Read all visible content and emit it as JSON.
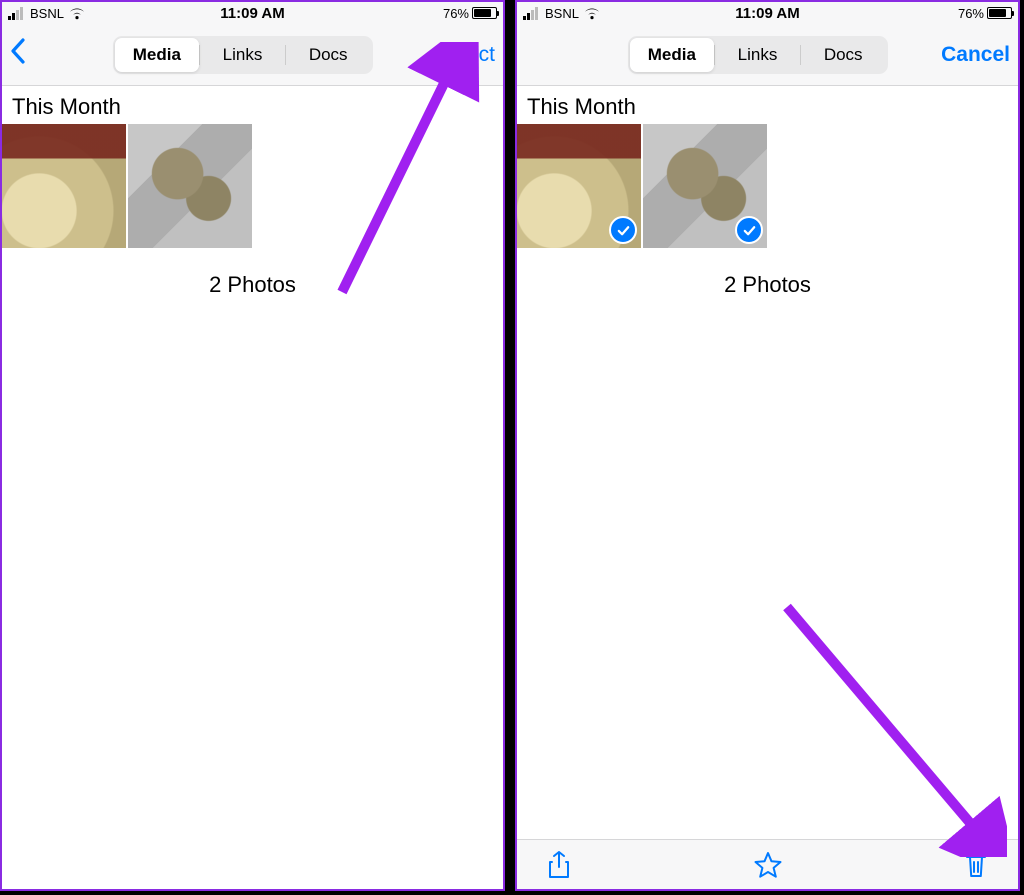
{
  "status": {
    "carrier": "BSNL",
    "time": "11:09 AM",
    "battery_pct": "76%"
  },
  "nav": {
    "tabs": {
      "media": "Media",
      "links": "Links",
      "docs": "Docs"
    },
    "select_label": "Select",
    "cancel_label": "Cancel"
  },
  "content": {
    "section_header": "This Month",
    "photo_count_label": "2 Photos"
  },
  "icons": {
    "back": "chevron-left",
    "share": "share-icon",
    "star": "star-icon",
    "trash": "trash-icon",
    "checkmark": "checkmark-icon",
    "wifi": "wifi-icon",
    "signal": "signal-icon",
    "battery": "battery-icon"
  },
  "colors": {
    "ios_blue": "#007aff",
    "annotation_purple": "#a020f0"
  }
}
